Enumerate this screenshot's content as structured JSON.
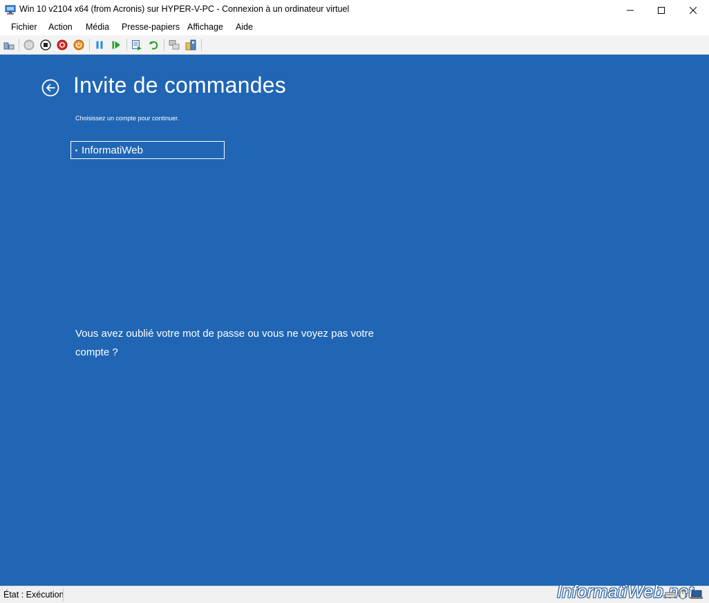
{
  "window": {
    "title": "Win 10 v2104 x64 (from Acronis) sur HYPER-V-PC - Connexion à un ordinateur virtuel"
  },
  "menu": {
    "items": [
      "Fichier",
      "Action",
      "Média",
      "Presse-papiers",
      "Affichage",
      "Aide"
    ]
  },
  "toolbar": {
    "icons": [
      "ctrl-alt-del-icon",
      "start-icon",
      "turn-off-icon",
      "shut-down-icon",
      "power-icon",
      "pause-icon",
      "resume-icon",
      "checkpoint-icon",
      "revert-icon",
      "enhanced-session-icon",
      "share-icon"
    ]
  },
  "screen": {
    "title": "Invite de commandes",
    "subtitle": "Choisissez un compte pour continuer.",
    "account": "InformatiWeb",
    "forgot": "Vous avez oublié votre mot de passe ou vous ne voyez pas votre compte ?",
    "background_color": "#2066b4"
  },
  "statusbar": {
    "status": "État : Exécution",
    "watermark": "InformatiWeb.net"
  }
}
